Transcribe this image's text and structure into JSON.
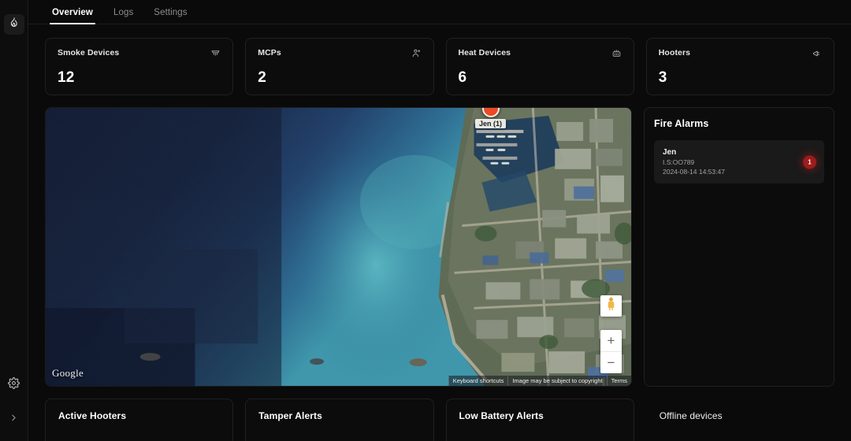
{
  "rail": {
    "brand_icon": "flame-icon",
    "settings_icon": "gear-icon",
    "expand_icon": "chevron-right-icon"
  },
  "tabs": [
    {
      "label": "Overview",
      "active": true
    },
    {
      "label": "Logs",
      "active": false
    },
    {
      "label": "Settings",
      "active": false
    }
  ],
  "stats": [
    {
      "label": "Smoke Devices",
      "value": "12",
      "icon": "smoke-detector-icon"
    },
    {
      "label": "MCPs",
      "value": "2",
      "icon": "call-point-icon"
    },
    {
      "label": "Heat Devices",
      "value": "6",
      "icon": "heat-detector-icon"
    },
    {
      "label": "Hooters",
      "value": "3",
      "icon": "megaphone-icon"
    }
  ],
  "map": {
    "marker_label": "Jen (1)",
    "attribution": "Google",
    "zoom_in_label": "+",
    "zoom_out_label": "−",
    "footer": [
      "Keyboard shortcuts",
      "Image may be subject to copyright",
      "Terms"
    ]
  },
  "alarms": {
    "title": "Fire Alarms",
    "items": [
      {
        "name": "Jen",
        "id": "I.S:OO789",
        "time": "2024-08-14 14:53:47",
        "count": "1"
      }
    ]
  },
  "bottom_cards": [
    {
      "title": "Active Hooters"
    },
    {
      "title": "Tamper Alerts"
    },
    {
      "title": "Low Battery Alerts"
    },
    {
      "title": "Offline devices"
    }
  ],
  "colors": {
    "page_bg": "#0a0a0a",
    "card_bg": "#0c0c0c",
    "card_border": "#202020",
    "accent_alarm": "#9e1b1b",
    "marker": "#ea4a26",
    "text_primary": "#ffffff",
    "text_muted": "#8d8d8d"
  }
}
